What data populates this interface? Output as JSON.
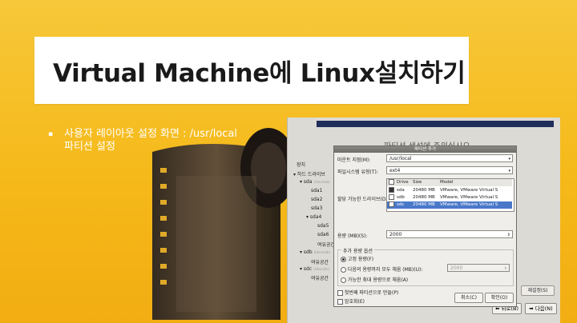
{
  "slide": {
    "title": "Virtual Machine에 Linux설치하기",
    "bullet_mark": "▪",
    "bullet_line1": "사용자 레이아웃 설정 화면 : /usr/local",
    "bullet_line2": "파티션 설정"
  },
  "installer": {
    "heading": "파티션 생성에 주의십시오",
    "tree": {
      "header": "장치",
      "rows": [
        {
          "label": "하드 드라이브"
        },
        {
          "label": "sda",
          "sub": "(/dev/sda)"
        },
        {
          "label": "sda1"
        },
        {
          "label": "sda2"
        },
        {
          "label": "sda3"
        },
        {
          "label": "sda4"
        },
        {
          "label": "sda5"
        },
        {
          "label": "sda6"
        },
        {
          "label": "여유공간"
        },
        {
          "label": "sdb",
          "sub": "(/dev/sdb)"
        },
        {
          "label": "여유공간"
        },
        {
          "label": "sdc",
          "sub": "(/dev/sdc)"
        },
        {
          "label": "여유공간"
        }
      ]
    },
    "reset_button": "재설정(S)",
    "back_button": "뒤로(B)",
    "next_button": "다음(N)",
    "dialog": {
      "title": "파티션 추가",
      "mount_label": "마운트 지점(M):",
      "mount_value": "/usr/local",
      "fs_label": "파일시스템 유형(T):",
      "fs_value": "ext4",
      "drives_label": "할당 가능한 드라이브(D):",
      "drive_columns": [
        "Drive",
        "Size",
        "Model"
      ],
      "drives": [
        {
          "drive": "sda",
          "size": "20480 MB",
          "model": "VMware, VMware Virtual S",
          "checked": true
        },
        {
          "drive": "sdb",
          "size": "20480 MB",
          "model": "VMware, VMware Virtual S",
          "checked": false
        },
        {
          "drive": "sdc",
          "size": "20480 MB",
          "model": "VMware, VMware Virtual S",
          "checked": false
        }
      ],
      "size_label": "용량 (MB)(S):",
      "size_value": "2000",
      "options_label": "추가 용량 옵션",
      "opt_fixed": "고정 용량(F)",
      "opt_fill_upto": "다음의 용량까지 모두 채움 (MB)(U):",
      "fill_upto_value": "2000",
      "opt_fill_max": "가능한 최대 용량으로 채움(A)",
      "primary_label": "첫번째 파티션으로 만들(P)",
      "encrypt_label": "암호화(E)",
      "cancel_button": "취소(C)",
      "ok_button": "확인(O)"
    }
  }
}
